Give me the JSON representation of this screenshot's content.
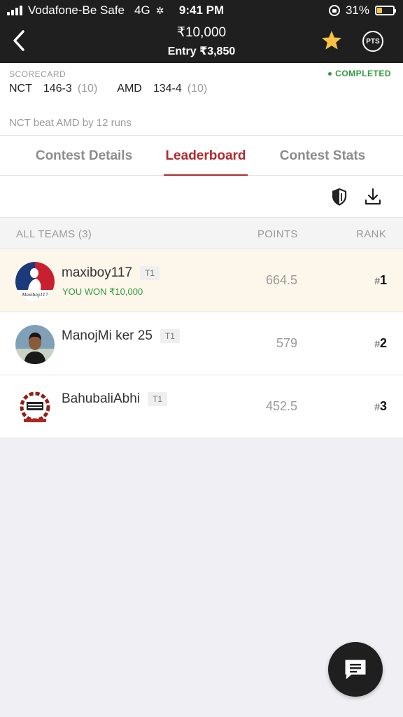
{
  "status_bar": {
    "carrier": "Vodafone-Be Safe",
    "network": "4G",
    "time": "9:41 PM",
    "battery": "31%",
    "battery_level": 0.31
  },
  "header": {
    "prize": "₹10,000",
    "entry": "Entry ₹3,850",
    "pts_label": "PTS",
    "star_color": "#f5c242"
  },
  "scorecard": {
    "label": "SCORECARD",
    "status": "COMPLETED",
    "teams": [
      {
        "name": "NCT",
        "score": "146-3",
        "overs": "(10)"
      },
      {
        "name": "AMD",
        "score": "134-4",
        "overs": "(10)"
      }
    ],
    "result": "NCT beat AMD by 12 runs"
  },
  "tabs": [
    {
      "label": "Contest Details",
      "active": false
    },
    {
      "label": "Leaderboard",
      "active": true
    },
    {
      "label": "Contest Stats",
      "active": false
    }
  ],
  "toolbar": {
    "icons": [
      "shield-compare-icon",
      "download-icon"
    ]
  },
  "leaderboard": {
    "headers": {
      "teams": "ALL TEAMS (3)",
      "points": "POINTS",
      "rank": "RANK"
    },
    "rows": [
      {
        "team": "maxiboy117",
        "badge": "T1",
        "won": "YOU WON ₹10,000",
        "points": "664.5",
        "rank_hash": "#",
        "rank": "1"
      },
      {
        "team": "ManojMi ker 25",
        "badge": "T1",
        "points": "579",
        "rank_hash": "#",
        "rank": "2"
      },
      {
        "team": "BahubaliAbhi",
        "badge": "T1",
        "points": "452.5",
        "rank_hash": "#",
        "rank": "3"
      }
    ]
  },
  "colors": {
    "accent": "#b02a30",
    "success": "#2e9a3e",
    "header_bg": "#1f1f1f",
    "winner_bg": "#fdf6eb"
  }
}
